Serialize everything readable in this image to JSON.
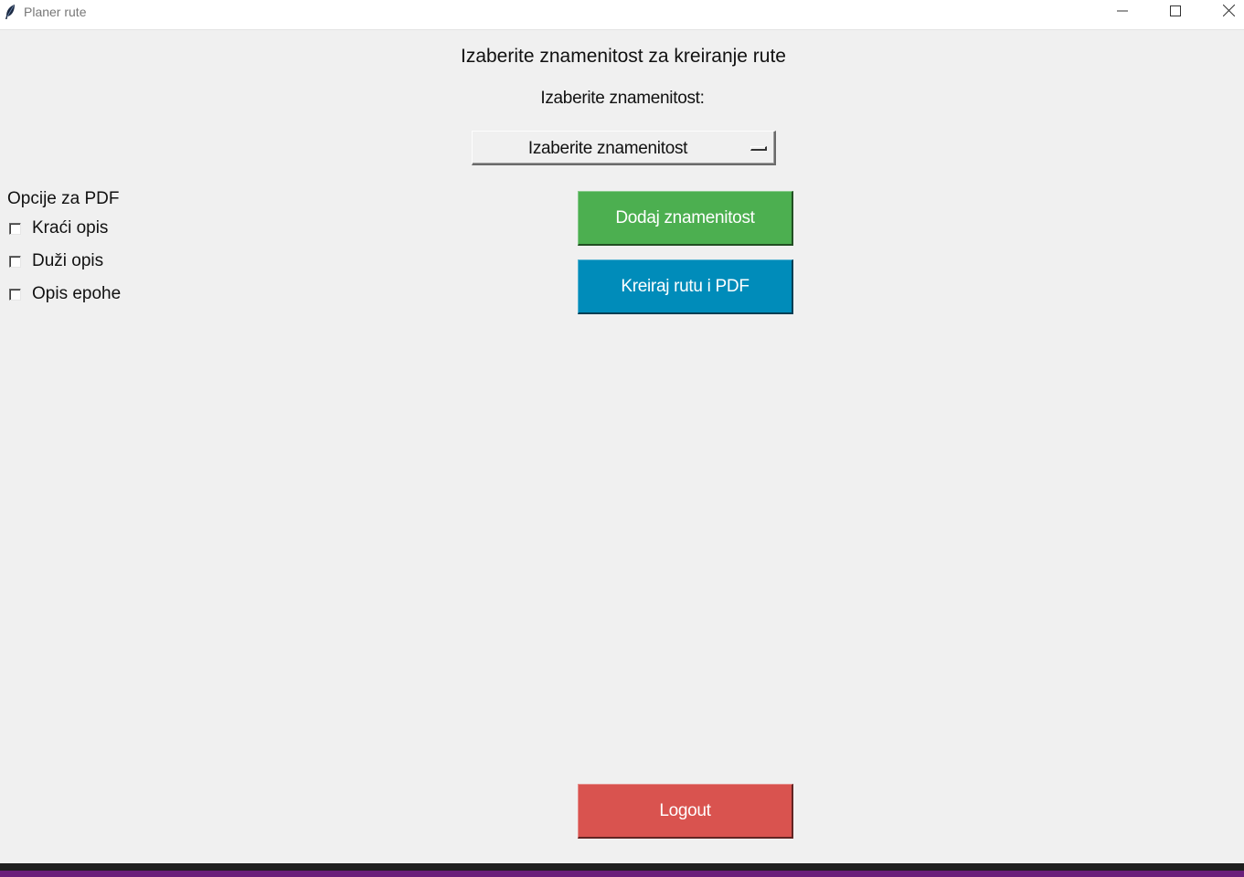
{
  "window": {
    "title": "Planer rute"
  },
  "main": {
    "heading": "Izaberite znamenitost za kreiranje rute",
    "select_label": "Izaberite znamenitost:",
    "select_value": "Izaberite znamenitost"
  },
  "pdf_options": {
    "title": "Opcije za PDF",
    "items": [
      {
        "label": "Kraći opis",
        "checked": false
      },
      {
        "label": "Duži opis",
        "checked": false
      },
      {
        "label": "Opis epohe",
        "checked": false
      }
    ]
  },
  "buttons": {
    "add_label": "Dodaj znamenitost",
    "create_label": "Kreiraj rutu i PDF",
    "logout_label": "Logout"
  },
  "colors": {
    "add": "#4caf50",
    "create": "#008cba",
    "logout": "#d9534f",
    "background": "#f0f0f0"
  },
  "icons": {
    "app": "feather-icon",
    "minimize": "minimize-icon",
    "maximize": "maximize-icon",
    "close": "close-icon"
  }
}
